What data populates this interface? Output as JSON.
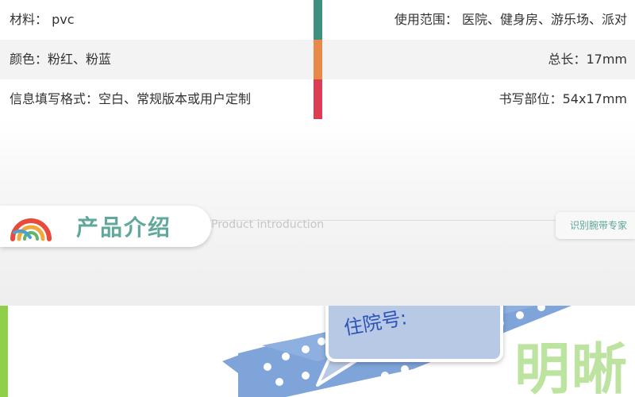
{
  "specs": {
    "rows": [
      {
        "left": "材料： pvc",
        "right": "使用范围： 医院、健身房、游乐场、派对",
        "bar_color": "#3f8f7f"
      },
      {
        "left": "颜色：粉红、粉蓝",
        "right": "总长：17mm",
        "bar_color": "#e8894a"
      },
      {
        "left": "信息填写格式：空白、常规版本或用户定制",
        "right": "书写部位：54x17mm",
        "bar_color": "#dc3d55"
      }
    ]
  },
  "section_header": {
    "title_cn": "产品介绍",
    "title_en": "Product introduction",
    "tag": "识别腕带专家",
    "logo_icon": "rainbow-arc-logo-icon",
    "title_color": "#5fa89b"
  },
  "product": {
    "bubble_text": "住院号:",
    "big_text": "明晰",
    "band_color": "#7fa4d9",
    "accent_green": "#8fcf4a"
  }
}
